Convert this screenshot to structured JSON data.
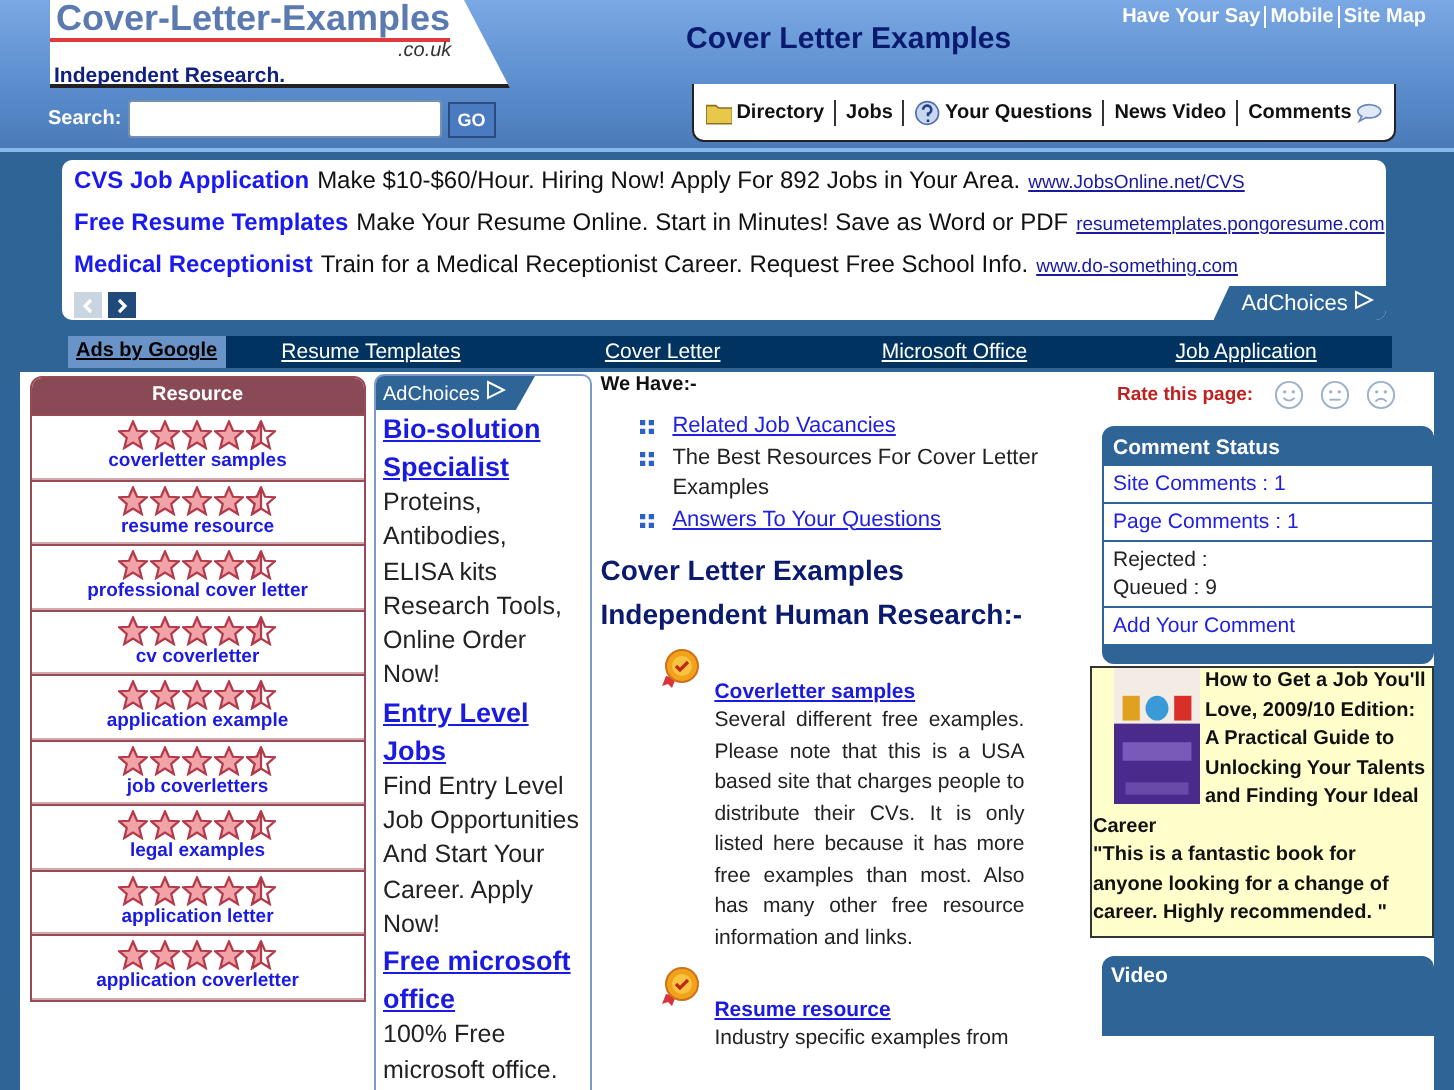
{
  "header": {
    "logo_title": "Cover-Letter-Examples",
    "logo_domain": ".co.uk",
    "tagline": "Independent Research.",
    "site_title": "Cover Letter Examples",
    "top_links": [
      "Have Your Say",
      "Mobile",
      "Site Map"
    ],
    "search": {
      "label": "Search:",
      "button": "GO"
    },
    "nav": [
      {
        "label": "Directory",
        "kind": "folder"
      },
      {
        "label": "Jobs",
        "kind": "plain"
      },
      {
        "label": "Your Questions",
        "kind": "question"
      },
      {
        "label": "News Video",
        "kind": "plain"
      },
      {
        "label": "Comments",
        "kind": "comment"
      }
    ]
  },
  "ads": [
    {
      "title": "CVS Job Application",
      "text": "Make $10-$60/Hour. Hiring Now! Apply For 892 Jobs in Your Area.",
      "url": "www.JobsOnline.net/CVS"
    },
    {
      "title": "Free Resume Templates",
      "text": "Make Your Resume Online. Start in Minutes! Save as Word or PDF",
      "url": "resumetemplates.pongoresume.com"
    },
    {
      "title": "Medical Receptionist",
      "text": "Train for a Medical Receptionist Career. Request Free School Info.",
      "url": "www.do-something.com"
    }
  ],
  "ad_choices": "AdChoices",
  "link_bar": {
    "label": "Ads by Google",
    "links": [
      "Resume Templates",
      "Cover Letter",
      "Microsoft Office",
      "Job Application"
    ]
  },
  "resources": {
    "title": "Resource",
    "items": [
      {
        "label": "coverletter samples",
        "stars": 4.5
      },
      {
        "label": "resume resource",
        "stars": 4.5
      },
      {
        "label": "professional cover letter",
        "stars": 4.5
      },
      {
        "label": "cv coverletter",
        "stars": 4.5
      },
      {
        "label": "application example",
        "stars": 4.5
      },
      {
        "label": "job coverletters",
        "stars": 4.5
      },
      {
        "label": "legal examples",
        "stars": 4.5
      },
      {
        "label": "application letter",
        "stars": 4.5
      },
      {
        "label": "application coverletter",
        "stars": 4.5
      }
    ]
  },
  "side_ads": {
    "ad_choices": "AdChoices",
    "items": [
      {
        "title": "Bio-solution Specialist",
        "text": "Proteins, Antibodies, ELISA kits Research Tools, Online Order Now!"
      },
      {
        "title": "Entry Level Jobs",
        "text": "Find Entry Level Job Opportunities And Start Your Career. Apply Now!"
      },
      {
        "title": "Free microsoft office",
        "text": "100% Free microsoft office."
      }
    ]
  },
  "main": {
    "we_have": "We Have:-",
    "bullets": [
      {
        "text": "Related Job Vacancies",
        "kind": "link"
      },
      {
        "text": "The Best Resources For Cover Letter Examples",
        "kind": "plain"
      },
      {
        "text": "Answers To Your Questions",
        "kind": "link"
      }
    ],
    "heading": [
      "Cover Letter Examples",
      "Independent Human Research:-"
    ],
    "entries": [
      {
        "title": "Coverletter samples",
        "text": "Several different free examples. Please note that this is a USA based site that charges people to distribute their CVs. It is only listed here because it has more free examples than most. Also has many other free resource information and links."
      },
      {
        "title": "Resume resource",
        "text": "Industry specific examples from"
      }
    ]
  },
  "right": {
    "rate_label": "Rate this page:",
    "rates": [
      {
        "kind": "happy"
      },
      {
        "kind": "neutral"
      },
      {
        "kind": "sad"
      }
    ],
    "comment_status": {
      "title": "Comment Status",
      "items": [
        {
          "lines": [
            "Site Comments : 1"
          ],
          "kind": "link"
        },
        {
          "lines": [
            "Page Comments : 1"
          ],
          "kind": "link"
        },
        {
          "lines": [
            "Rejected :",
            "Queued : 9"
          ],
          "kind": "plain"
        },
        {
          "lines": [
            "Add Your Comment"
          ],
          "kind": "link"
        }
      ]
    },
    "book": {
      "title": "How to Get a Job You'll Love, 2009/10 Edition: A Practical Guide to Unlocking Your Talents and Finding Your Ideal Career",
      "quote": "\"This is a fantastic book for anyone looking for a change of career. Highly recommended. \""
    },
    "video_title": "Video"
  }
}
